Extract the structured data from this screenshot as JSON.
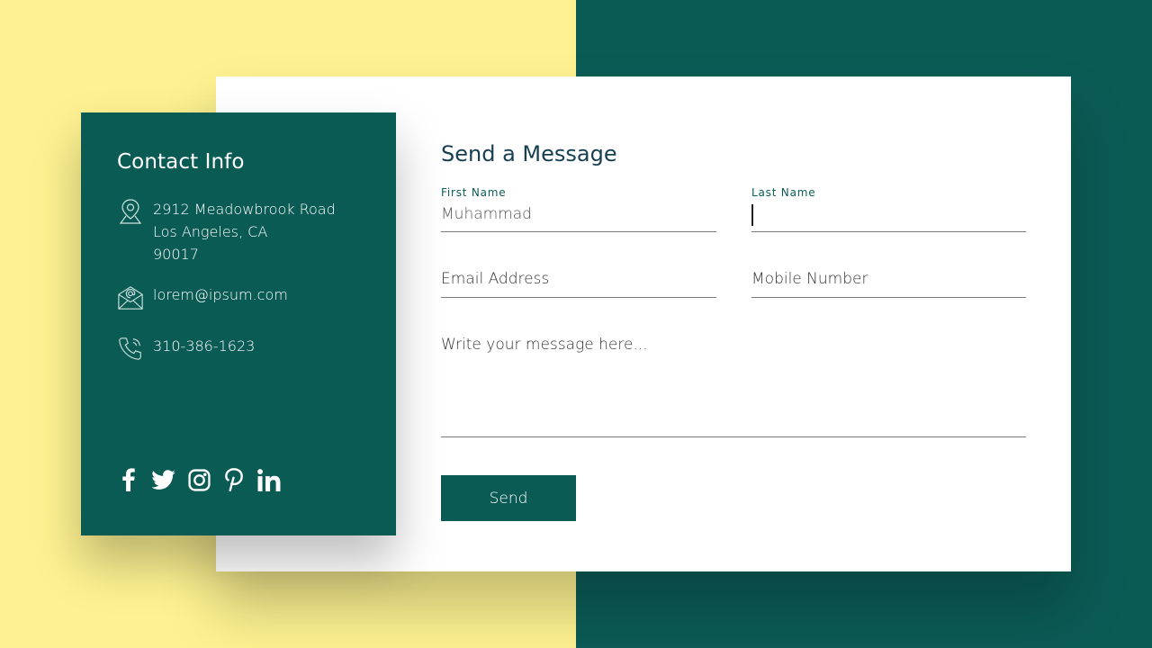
{
  "colors": {
    "accent": "#0b5b55",
    "background_left": "#fdf191",
    "background_right": "#0b5b55",
    "card": "#ffffff",
    "title_text": "#163f52"
  },
  "contact_info": {
    "title": "Contact Info",
    "address": {
      "icon": "location-pin-icon",
      "line1": "2912 Meadowbrook Road",
      "line2": "Los Angeles, CA",
      "line3": "90017"
    },
    "email": {
      "icon": "envelope-icon",
      "value": "lorem@ipsum.com"
    },
    "phone": {
      "icon": "phone-icon",
      "value": "310-386-1623"
    },
    "socials": [
      {
        "name": "facebook",
        "icon": "facebook-icon"
      },
      {
        "name": "twitter",
        "icon": "twitter-icon"
      },
      {
        "name": "instagram",
        "icon": "instagram-icon"
      },
      {
        "name": "pinterest",
        "icon": "pinterest-icon"
      },
      {
        "name": "linkedin",
        "icon": "linkedin-icon"
      }
    ]
  },
  "form": {
    "title": "Send a Message",
    "first_name": {
      "label": "First Name",
      "value": "Muhammad"
    },
    "last_name": {
      "label": "Last Name",
      "value": ""
    },
    "email": {
      "placeholder": "Email Address"
    },
    "mobile": {
      "placeholder": "Mobile Number"
    },
    "message": {
      "placeholder": "Write your message here..."
    },
    "send_label": "Send"
  }
}
